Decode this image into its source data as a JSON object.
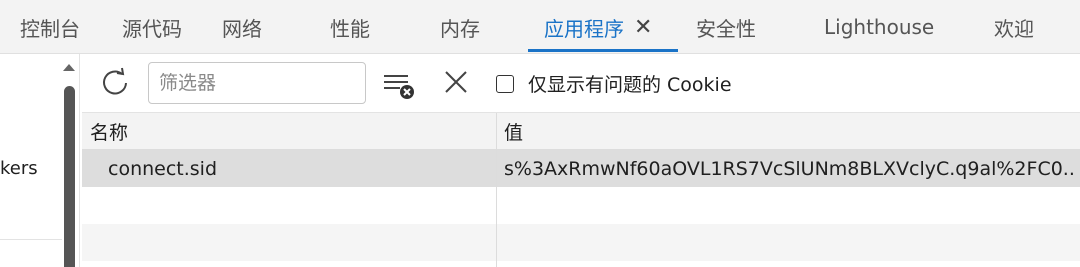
{
  "tabs": [
    {
      "label": "控制台"
    },
    {
      "label": "源代码"
    },
    {
      "label": "网络"
    },
    {
      "label": "性能"
    },
    {
      "label": "内存"
    },
    {
      "label": "应用程序",
      "active": true
    },
    {
      "label": "安全性"
    },
    {
      "label": "Lighthouse"
    },
    {
      "label": "欢迎"
    }
  ],
  "tab_close_glyph": "✕",
  "sidebar": {
    "partial_item": "kers"
  },
  "toolbar": {
    "filter_placeholder": "筛选器",
    "only_issues_label": "仅显示有问题的 Cookie",
    "only_issues_checked": false
  },
  "table": {
    "columns": [
      "名称",
      "值"
    ],
    "rows": [
      {
        "name": "connect.sid",
        "value": "s%3AxRmwNf60aOVL1RS7VcSlUNm8BLXVclyC.q9al%2FC0...",
        "selected": true
      }
    ]
  },
  "colors": {
    "accent": "#1a73c7",
    "selected_row": "#dddddd"
  }
}
